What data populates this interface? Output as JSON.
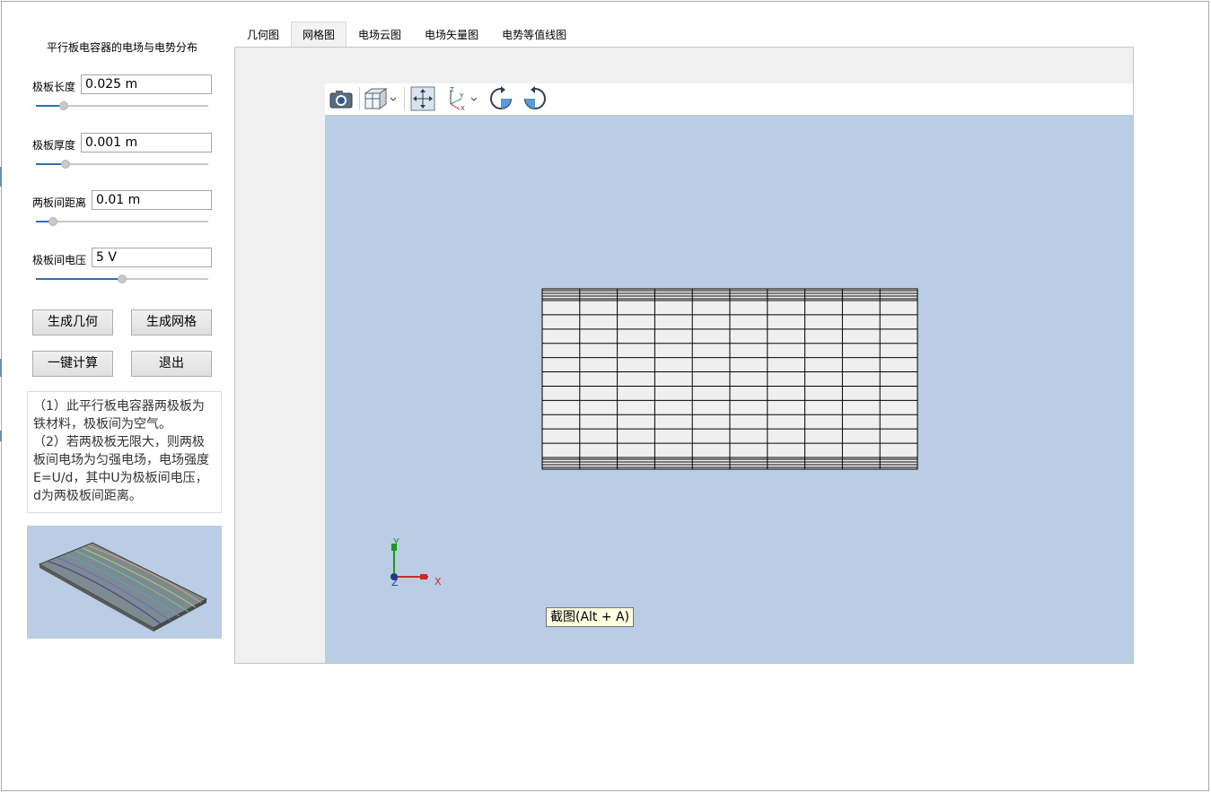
{
  "panel": {
    "title": "平行板电容器的电场与电势分布",
    "params": [
      {
        "label": "极板长度",
        "value": "0.025 m",
        "slider_fraction": 0.16
      },
      {
        "label": "极板厚度",
        "value": "0.001 m",
        "slider_fraction": 0.17
      },
      {
        "label": "两板间距离",
        "value": "0.01 m",
        "slider_fraction": 0.1
      },
      {
        "label": "极板间电压",
        "value": "5 V",
        "slider_fraction": 0.5
      }
    ],
    "buttons": {
      "gen_geometry": "生成几何",
      "gen_mesh": "生成网格",
      "compute": "一键计算",
      "exit": "退出"
    },
    "description": [
      "（1）此平行板电容器两极板为铁材料，极板间为空气。",
      "（2）若两极板无限大，则两极板间电场为匀强电场，电场强度E=U/d，其中U为极板间电压，d为两极板间距离。"
    ]
  },
  "tabs": [
    {
      "label": "几何图",
      "active": false
    },
    {
      "label": "网格图",
      "active": true
    },
    {
      "label": "电场云图",
      "active": false
    },
    {
      "label": "电场矢量图",
      "active": false
    },
    {
      "label": "电势等值线图",
      "active": false
    }
  ],
  "toolbar": {
    "icons": [
      "camera-icon",
      "view-cube-icon",
      "fit-view-icon",
      "axes-orientation-icon",
      "rotate-cw-icon",
      "rotate-ccw-icon"
    ]
  },
  "viewer": {
    "axis_labels": {
      "x": "X",
      "y": "Y",
      "z": "Z"
    },
    "mesh": {
      "columns": 10,
      "rows": 11,
      "dense_bands": 4
    },
    "tooltip": "截图(Alt + A)"
  },
  "colors": {
    "canvas_bg": "#b9cde4",
    "accent": "#2f6fb0"
  }
}
